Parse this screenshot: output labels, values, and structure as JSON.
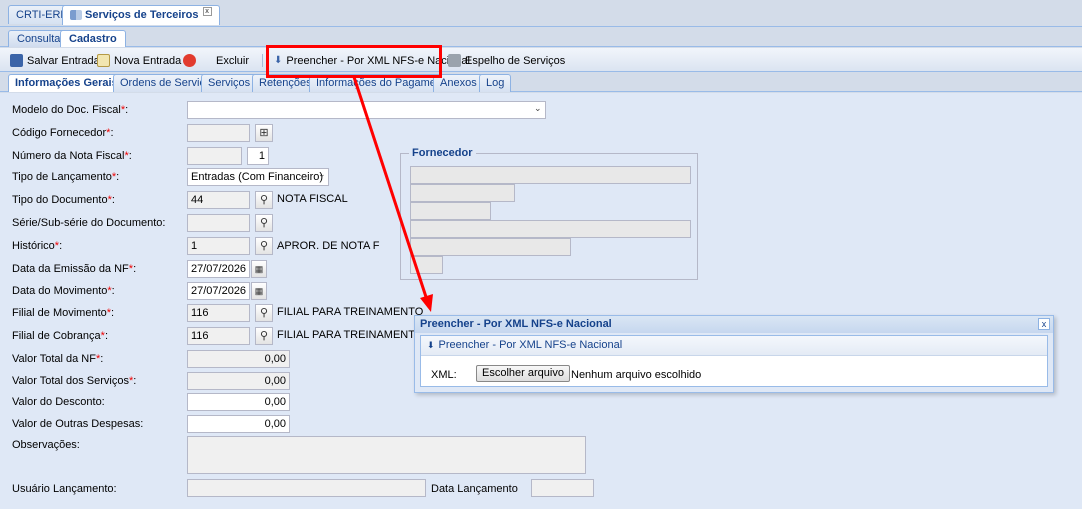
{
  "window_tabs": [
    {
      "label": "CRTI-ERP"
    },
    {
      "label": "Serviços de Terceiros",
      "close": "x"
    }
  ],
  "mode_tabs": [
    "Consulta",
    "Cadastro"
  ],
  "toolbar": {
    "save": "Salvar Entrada",
    "new": "Nova Entrada",
    "delete": "Excluir",
    "fill_xml": "Preencher - Por XML NFS-e Nacional",
    "mirror": "Espelho de Serviços"
  },
  "form_tabs": [
    "Informações Gerais",
    "Ordens de Serviço",
    "Serviços",
    "Retenções",
    "Informações do Pagamento",
    "Anexos",
    "Log"
  ],
  "form": {
    "modelo_label": "Modelo do Doc. Fiscal",
    "codigo_fornecedor_label": "Código Fornecedor",
    "numero_nf_label": "Número da Nota Fiscal",
    "numero_nf_serie": "1",
    "tipo_lancamento_label": "Tipo de Lançamento",
    "tipo_lancamento_value": "Entradas (Com Financeiro)",
    "tipo_documento_label": "Tipo do Documento",
    "tipo_documento_value": "44",
    "tipo_documento_desc": "NOTA FISCAL",
    "serie_label": "Série/Sub-série do Documento:",
    "historico_label": "Histórico",
    "historico_value": "1",
    "historico_desc": "APROR. DE NOTA F",
    "data_emissao_label": "Data da Emissão da NF",
    "data_emissao_value": "27/07/2026",
    "data_movimento_label": "Data do Movimento",
    "data_movimento_value": "27/07/2026",
    "filial_movimento_label": "Filial de Movimento",
    "filial_movimento_value": "116",
    "filial_movimento_desc": "FILIAL PARA TREINAMENTO",
    "filial_cobranca_label": "Filial de Cobrança",
    "filial_cobranca_value": "116",
    "filial_cobranca_desc": "FILIAL PARA TREINAMENTO",
    "valor_total_nf_label": "Valor Total da NF",
    "valor_total_nf_value": "0,00",
    "valor_total_servicos_label": "Valor Total dos Serviços",
    "valor_total_servicos_value": "0,00",
    "valor_desconto_label": "Valor do Desconto:",
    "valor_desconto_value": "0,00",
    "valor_outras_label": "Valor de Outras Despesas:",
    "valor_outras_value": "0,00",
    "observacoes_label": "Observações:",
    "usuario_label": "Usuário Lançamento:",
    "data_lancamento_label": "Data Lançamento",
    "fornecedor_legend": "Fornecedor",
    "required_mark": "*",
    "colon": ":"
  },
  "popup": {
    "title": "Preencher - Por XML NFS-e Nacional",
    "subtitle": "Preencher - Por XML NFS-e Nacional",
    "xml_label": "XML:",
    "file_button": "Escolher arquivo",
    "no_file": "Nenhum arquivo escolhido",
    "close": "x"
  },
  "colors": {
    "accent": "#15428b",
    "highlight": "#ff0000",
    "arrow": "#ff0000"
  }
}
